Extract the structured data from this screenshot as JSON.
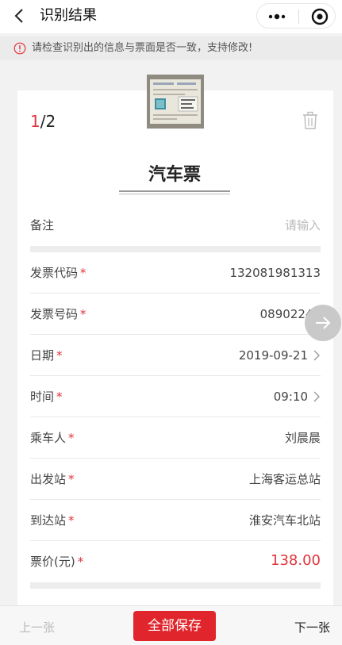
{
  "nav": {
    "title": "识别结果",
    "back_icon": "chevron-left-icon",
    "more_icon": "more-dots-icon",
    "close_icon": "target-close-icon"
  },
  "notice": {
    "icon": "alert-circle-icon",
    "text": "请检查识别出的信息与票面是否一致，支持修改!",
    "color": "#e0353b"
  },
  "card": {
    "page_current": "1",
    "page_rest": "/2",
    "ticket_title": "汽车票",
    "delete_icon": "trash-icon",
    "fields": [
      {
        "label": "备注",
        "required": false,
        "value": "请输入",
        "placeholder": true,
        "arrow": false
      },
      {
        "label": "发票代码",
        "required": true,
        "value": "132081981313",
        "arrow": false
      },
      {
        "label": "发票号码",
        "required": true,
        "value": "08902241",
        "arrow": false
      },
      {
        "label": "日期",
        "required": true,
        "value": "2019-09-21",
        "arrow": true
      },
      {
        "label": "时间",
        "required": true,
        "value": "09:10",
        "arrow": true
      },
      {
        "label": "乘车人",
        "required": true,
        "value": "刘晨晨",
        "arrow": false
      },
      {
        "label": "出发站",
        "required": true,
        "value": "上海客运总站",
        "arrow": false
      },
      {
        "label": "到达站",
        "required": true,
        "value": "淮安汽车北站",
        "arrow": false
      },
      {
        "label": "票价(元)",
        "required": true,
        "value": "138.00",
        "arrow": false,
        "price": true
      }
    ],
    "required_mark": "*"
  },
  "footer": {
    "prev_label": "上一张",
    "save_label": "全部保存",
    "next_label": "下一张"
  },
  "colors": {
    "accent": "#e0262c",
    "required": "#e0353b"
  }
}
